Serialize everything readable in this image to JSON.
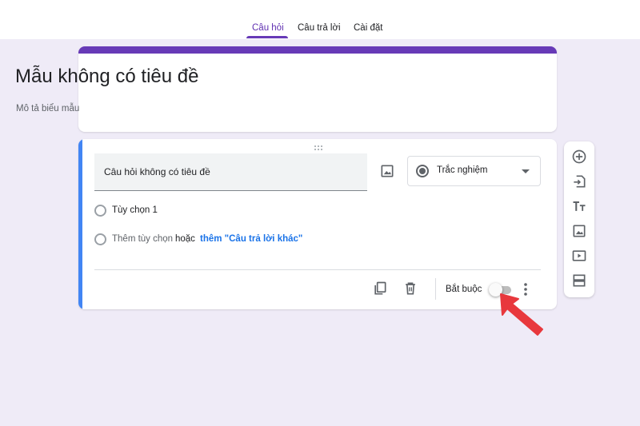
{
  "tabs": [
    {
      "label": "Câu hỏi",
      "active": true
    },
    {
      "label": "Câu trả lời",
      "active": false
    },
    {
      "label": "Cài đặt",
      "active": false
    }
  ],
  "form": {
    "title": "Mẫu không có tiêu đề",
    "description": "Mô tả biểu mẫu"
  },
  "question": {
    "title": "Câu hỏi không có tiêu đề",
    "type": "Trắc nghiệm",
    "options": [
      "Tùy chọn 1"
    ],
    "add_option": "Thêm tùy chọn",
    "or_text": "hoặc",
    "add_other": "thêm \"Câu trả lời khác\"",
    "required_label": "Bắt buộc",
    "required": false
  },
  "side_toolbar": [
    "add-question-icon",
    "import-questions-icon",
    "add-title-icon",
    "add-image-icon",
    "add-video-icon",
    "add-section-icon"
  ],
  "colors": {
    "brand": "#673ab7",
    "background": "#efebf7",
    "active_question": "#4285f4",
    "link": "#1a73e8",
    "annotation_arrow": "#e8383d"
  }
}
